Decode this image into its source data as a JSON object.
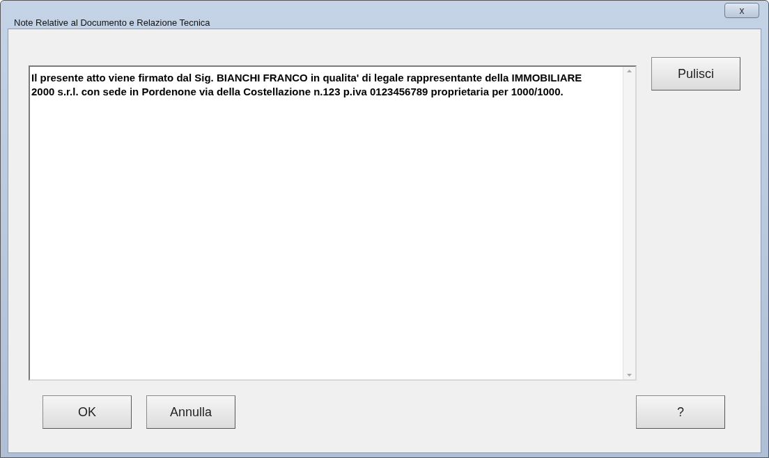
{
  "window": {
    "title": "Note Relative al Documento e Relazione Tecnica",
    "close": "x"
  },
  "notes_field": {
    "value": "Il presente atto viene firmato dal Sig. BIANCHI FRANCO in qualita' di legale rappresentante della IMMOBILIARE 2000 s.r.l. con sede in Pordenone via della Costellazione n.123 p.iva 0123456789 proprietaria per 1000/1000."
  },
  "side_buttons": [
    "Pulisci"
  ],
  "bottom_buttons": [
    "OK",
    "Annulla"
  ],
  "help_button": "?"
}
